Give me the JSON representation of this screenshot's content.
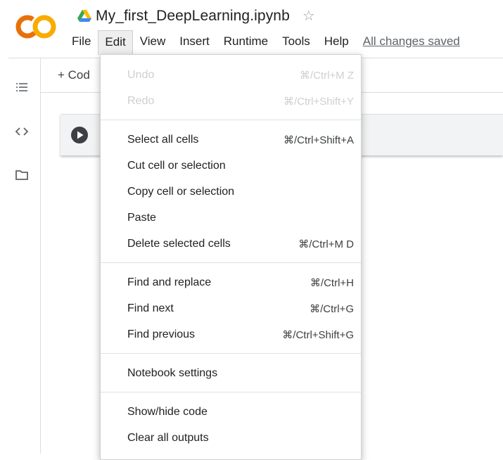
{
  "header": {
    "logo_text": "CO",
    "title": "My_first_DeepLearning.ipynb",
    "saved_status": "All changes saved"
  },
  "menubar": {
    "items": [
      "File",
      "Edit",
      "View",
      "Insert",
      "Runtime",
      "Tools",
      "Help"
    ]
  },
  "toolbar": {
    "add_code_label": "+ Cod"
  },
  "edit_menu": {
    "undo": {
      "label": "Undo",
      "shortcut": "⌘/Ctrl+M Z"
    },
    "redo": {
      "label": "Redo",
      "shortcut": "⌘/Ctrl+Shift+Y"
    },
    "select_all": {
      "label": "Select all cells",
      "shortcut": "⌘/Ctrl+Shift+A"
    },
    "cut": {
      "label": "Cut cell or selection"
    },
    "copy": {
      "label": "Copy cell or selection"
    },
    "paste": {
      "label": "Paste"
    },
    "delete": {
      "label": "Delete selected cells",
      "shortcut": "⌘/Ctrl+M D"
    },
    "find_replace": {
      "label": "Find and replace",
      "shortcut": "⌘/Ctrl+H"
    },
    "find_next": {
      "label": "Find next",
      "shortcut": "⌘/Ctrl+G"
    },
    "find_previous": {
      "label": "Find previous",
      "shortcut": "⌘/Ctrl+Shift+G"
    },
    "notebook_settings": {
      "label": "Notebook settings"
    },
    "show_hide_code": {
      "label": "Show/hide code"
    },
    "clear_outputs": {
      "label": "Clear all outputs"
    }
  },
  "icons": {
    "logo": "colab-logo-icon",
    "drive": "google-drive-icon",
    "star": "star-outline-icon",
    "toc": "table-of-contents-icon",
    "code_snippets": "code-brackets-icon",
    "files": "folder-icon",
    "run": "play-circle-icon"
  },
  "colors": {
    "logo_orange": "#F9AB00",
    "logo_dark_orange": "#E8710A",
    "menu_active_bg": "#EEEEEE",
    "disabled_text": "#CFCFCF"
  }
}
